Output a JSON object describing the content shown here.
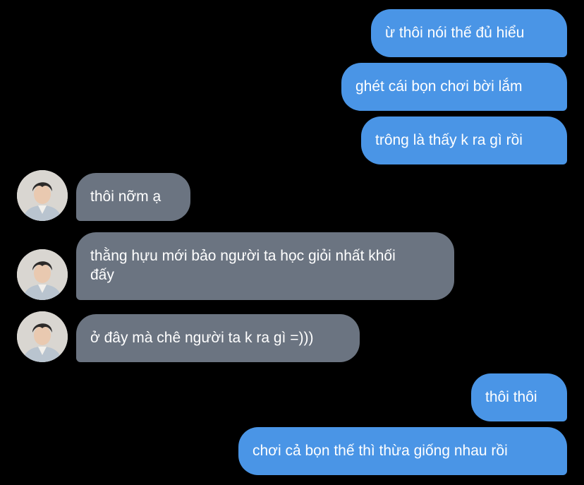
{
  "conversation": {
    "messages": [
      {
        "side": "sent",
        "text": "ừ thôi nói thế đủ hiểu"
      },
      {
        "side": "sent",
        "text": "ghét cái bọn chơi bời lắm"
      },
      {
        "side": "sent",
        "text": "trông là thấy k ra gì rồi"
      },
      {
        "side": "received",
        "text": "thôi nỡm ạ"
      },
      {
        "side": "received",
        "text": "thằng hựu mới bảo người ta học giỏi nhất khối đấy"
      },
      {
        "side": "received",
        "text": "ở đây mà chê người ta k ra gì =)))"
      },
      {
        "side": "sent",
        "text": "thôi thôi"
      },
      {
        "side": "sent",
        "text": "chơi cả bọn thế thì thừa giống nhau rồi"
      }
    ]
  },
  "colors": {
    "background": "#000000",
    "sent_bubble": "#4a95e6",
    "received_bubble": "#6b7481",
    "text": "#ffffff"
  },
  "icons": {
    "avatar": "contact-avatar-photo"
  }
}
